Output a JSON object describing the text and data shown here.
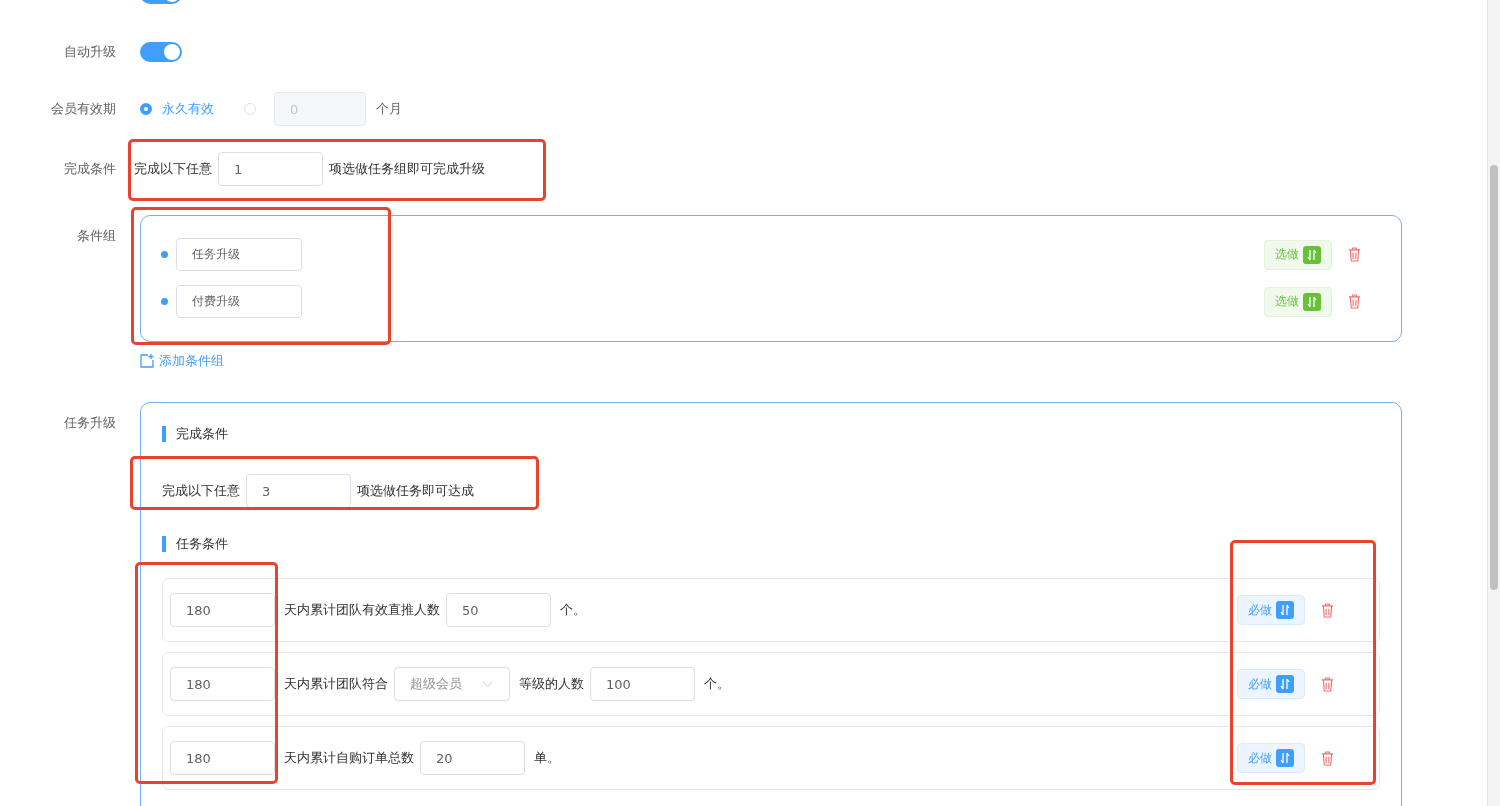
{
  "top_toggle": {
    "on": true
  },
  "auto_upgrade": {
    "label": "自动升级",
    "on": true
  },
  "validity": {
    "label": "会员有效期",
    "options": [
      {
        "label": "永久有效",
        "selected": true
      },
      {
        "selected": false
      }
    ],
    "months_value": "0",
    "months_unit": "个月"
  },
  "completion": {
    "label": "完成条件",
    "prefix": "完成以下任意",
    "value": "1",
    "suffix": "项选做任务组即可完成升级"
  },
  "condition_groups": {
    "label": "条件组",
    "items": [
      {
        "name": "任务升级",
        "tag": "选做",
        "kind": "optional"
      },
      {
        "name": "付费升级",
        "tag": "选做",
        "kind": "optional"
      }
    ],
    "add_label": "添加条件组"
  },
  "task_upgrade": {
    "label": "任务升级",
    "completion_heading": "完成条件",
    "prefix": "完成以下任意",
    "value": "3",
    "suffix": "项选做任务即可达成",
    "tasks_heading": "任务条件",
    "tasks": [
      {
        "tag": "必做",
        "kind": "required",
        "parts": [
          {
            "kind": "input",
            "text": "180"
          },
          {
            "kind": "text",
            "text": "天内累计团队有效直推人数"
          },
          {
            "kind": "input",
            "text": "50"
          },
          {
            "kind": "text",
            "text": "个。"
          }
        ]
      },
      {
        "tag": "必做",
        "kind": "required",
        "parts": [
          {
            "kind": "input",
            "text": "180"
          },
          {
            "kind": "text",
            "text": "天内累计团队符合"
          },
          {
            "kind": "select",
            "text": "超级会员"
          },
          {
            "kind": "text",
            "text": "等级的人数"
          },
          {
            "kind": "input",
            "text": "100"
          },
          {
            "kind": "text",
            "text": "个。"
          }
        ]
      },
      {
        "tag": "必做",
        "kind": "required",
        "parts": [
          {
            "kind": "input",
            "text": "180"
          },
          {
            "kind": "text",
            "text": "天内累计自购订单总数"
          },
          {
            "kind": "input",
            "text": "20"
          },
          {
            "kind": "text",
            "text": "单。"
          }
        ]
      }
    ]
  }
}
